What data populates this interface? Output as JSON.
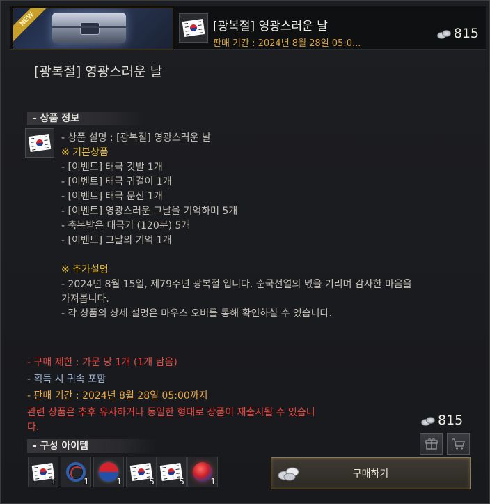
{
  "header": {
    "badge": "NEW",
    "title": "[광복절] 영광스러운 날",
    "period": "판매 기간 : 2024년 8월 28일 05:0...",
    "price": "815"
  },
  "main_title": "[광복절] 영광스러운 날",
  "info": {
    "heading": "- 상품 정보",
    "description": "- 상품 설명 : [광복절] 영광스러운 날",
    "basic_heading": "※ 기본상품",
    "basic_items": [
      "- [이벤트] 태극 깃발 1개",
      "- [이벤트] 태극 귀걸이 1개",
      "- [이벤트] 태극 문신 1개",
      "- [이벤트] 영광스러운 그날을 기억하며 5개",
      "- 축복받은 태극기 (120분) 5개",
      "- [이벤트] 그날의 기억 1개"
    ],
    "extra_heading": "※ 추가설명",
    "extra_lines": [
      "- 2024년 8월 15일, 제79주년 광복절 입니다. 순국선열의 넋을 기리며 감사한 마음을",
      "가져봅니다.",
      "- 각 상품의 상세 설명은 마우스 오버를 통해 확인하실 수 있습니다."
    ]
  },
  "limits": {
    "purchase_prefix": "- 구매 제한 : 가문 당 1개 (",
    "purchase_remaining": "1",
    "purchase_suffix": "개 남음)",
    "bound": "- 획득 시 귀속 포함",
    "period": "- 판매 기간 : 2024년 8월 28일 05:00까지",
    "notice_line1": "관련 상품은 추후 유사하거나 동일한 형태로 상품이 재출시될 수 있습니",
    "notice_line2": "다."
  },
  "components": {
    "heading": "- 구성 아이템",
    "items": [
      {
        "icon": "korean-flag-icon",
        "count": "1"
      },
      {
        "icon": "taegeuk-earring-icon",
        "count": "1"
      },
      {
        "icon": "taegeuk-tattoo-icon",
        "count": "1"
      },
      {
        "icon": "korean-flag-icon",
        "count": "5"
      },
      {
        "icon": "korean-flag-icon",
        "count": "5"
      },
      {
        "icon": "taegeuk-orb-icon",
        "count": "1"
      }
    ]
  },
  "purchase": {
    "price": "815",
    "buy_label": "구매하기"
  },
  "colors": {
    "gold": "#e8bd3b",
    "red": "#e34a43",
    "blue": "#9eb4d4",
    "orange": "#e9a743"
  }
}
